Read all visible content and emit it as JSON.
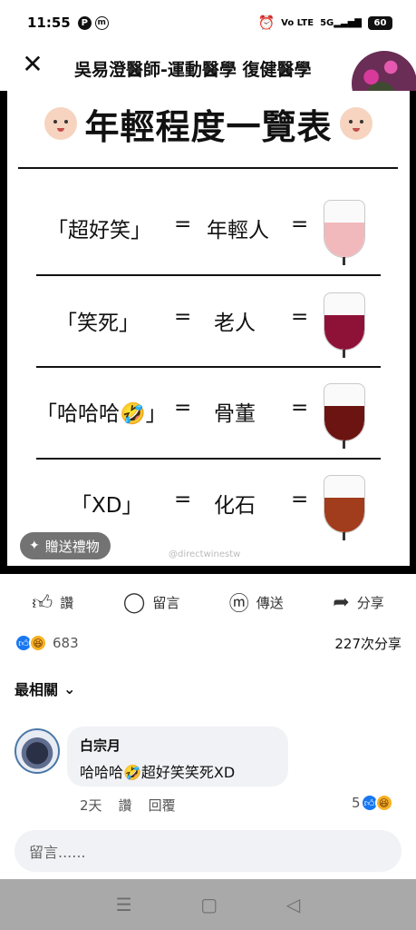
{
  "status_bar": {
    "time": "11:55",
    "left_icons": [
      "P",
      "m"
    ],
    "network": "Vo LTE",
    "signal": "5G",
    "battery": "60"
  },
  "post": {
    "page_name": "吳易澄醫師-運動醫學 復健醫學"
  },
  "image": {
    "title": "年輕程度一覽表",
    "rows": [
      {
        "phrase": "「超好笑」",
        "eq1": "=",
        "meaning": "年輕人",
        "eq2": "=",
        "wine_color": "#f2b9bd"
      },
      {
        "phrase": "「笑死」",
        "eq1": "=",
        "meaning": "老人",
        "eq2": "=",
        "wine_color": "#8e1238"
      },
      {
        "phrase": "「哈哈哈🤣」",
        "eq1": "=",
        "meaning": "骨董",
        "eq2": "=",
        "wine_color": "#6b1412"
      },
      {
        "phrase": "「XD」",
        "eq1": "=",
        "meaning": "化石",
        "eq2": "=",
        "wine_color": "#a13c1c"
      }
    ],
    "gift_label": "贈送禮物",
    "watermark": "@directwinestw"
  },
  "actions": {
    "like": "讚",
    "comment": "留言",
    "messenger": "傳送",
    "share": "分享"
  },
  "stats": {
    "reaction_count": "683",
    "shares": "227次分享"
  },
  "sort_label": "最相關",
  "comment": {
    "name": "白宗月",
    "text": "哈哈哈🤣超好笑笑死XD",
    "time": "2天",
    "like": "讚",
    "reply": "回覆",
    "reaction_count": "5"
  },
  "composer": {
    "placeholder": "留言......"
  },
  "colors": {
    "accent": "#1877f2",
    "haha": "#f7b125"
  }
}
